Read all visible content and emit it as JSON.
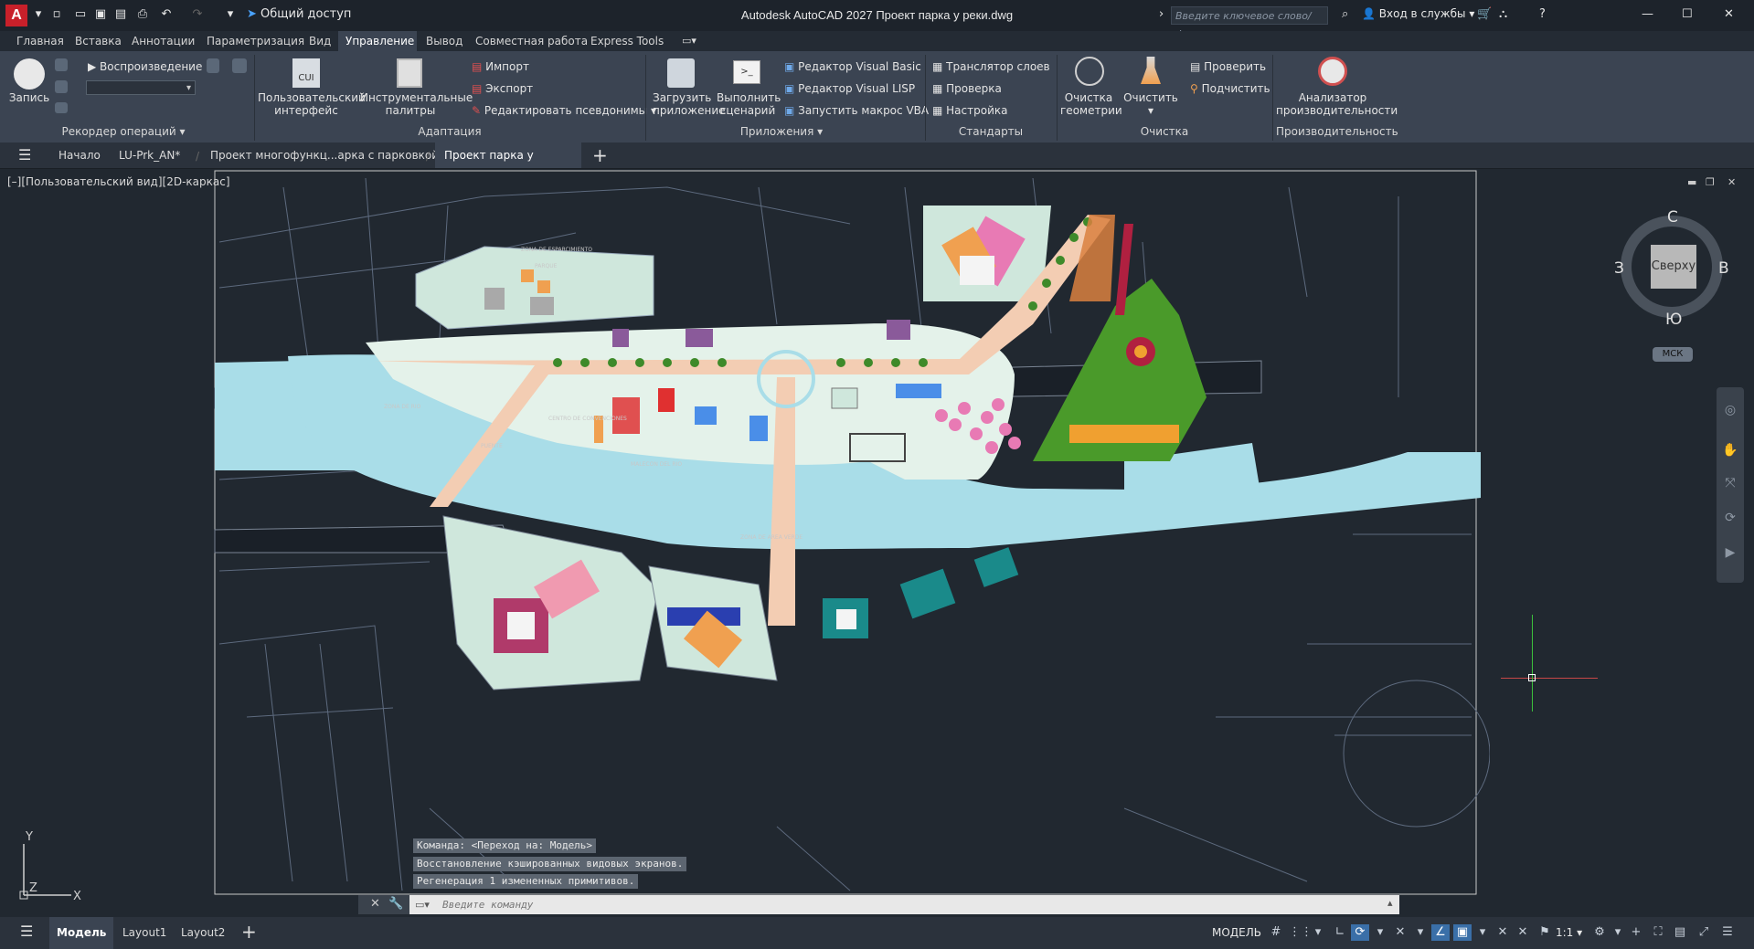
{
  "app": {
    "logo": "A",
    "title": "Autodesk AutoCAD 2027   Проект парка у реки.dwg",
    "share": "Общий доступ",
    "search_placeholder": "Введите ключевое слово/фразу",
    "signin": "Вход в службы"
  },
  "ribbon_tabs": [
    "Главная",
    "Вставка",
    "Аннотации",
    "Параметризация",
    "Вид",
    "Управление",
    "Вывод",
    "Совместная работа",
    "Express Tools"
  ],
  "active_ribbon_tab": "Управление",
  "ribbon": {
    "record": "Запись",
    "playback": "Воспроизведение",
    "action_recorder": "Рекордер операций",
    "cui_icon_text": "CUI",
    "user_interface": "Пользовательский интерфейс",
    "tool_palettes": "Инструментальные палитры",
    "import": "Импорт",
    "export": "Экспорт",
    "edit_aliases": "Редактировать псевдонимы",
    "customization": "Адаптация",
    "load_app": "Загрузить приложение",
    "run_script": "Выполнить сценарий",
    "vb_editor": "Редактор Visual Basic",
    "lisp_editor": "Редактор Visual LISP",
    "run_vba": "Запустить макрос VBA",
    "applications": "Приложения",
    "layer_translator": "Транслятор  слоев",
    "check": "Проверка",
    "configure": "Настройка",
    "cad_standards": "Стандарты оформления",
    "overkill": "Очистка геометрии",
    "purge": "Очистить",
    "verify": "Проверить",
    "count": "Подчистить",
    "cleanup": "Очистка",
    "perf_analyzer": "Анализатор производительности",
    "performance": "Производительность"
  },
  "doc_tabs": [
    "Начало",
    "LU-Prk_AN*",
    "Проект многофункц...арка с парковкой*",
    "Проект парка у реки*"
  ],
  "active_doc_tab": "Проект парка у реки*",
  "viewport_label": "[–][Пользовательский вид][2D-каркас]",
  "viewcube": {
    "top": "Сверху",
    "n": "С",
    "s": "Ю",
    "w": "З",
    "e": "В",
    "wcs": "МСК"
  },
  "drawing_labels": {
    "parque": "PARQUE",
    "zona_esp": "ZONA DE ESPARCIMIENTO",
    "centro": "CENTRO DE CONVENCIONES",
    "malecon": "MALECON DEL RIO",
    "puente": "PUENTE",
    "zona_rio": "ZONA DE RIO",
    "zona_verde": "ZONA DE AREA VERDE"
  },
  "command_history": [
    "Команда:  <Переход на: Модель>",
    "Восстановление кэшированных видовых экранов.",
    "Регенерация 1 измененных примитивов."
  ],
  "command_placeholder": "Введите команду",
  "layout_tabs": [
    "Модель",
    "Layout1",
    "Layout2"
  ],
  "active_layout": "Модель",
  "status": {
    "model": "МОДЕЛЬ",
    "scale": "1:1"
  },
  "colors": {
    "accent": "#3a6fa8",
    "logo": "#c8202a",
    "water": "#a9dde8",
    "plaza": "#f3cdb3",
    "park": "#cfe7dc",
    "pink": "#e87ab4",
    "green": "#4a9a2a"
  }
}
